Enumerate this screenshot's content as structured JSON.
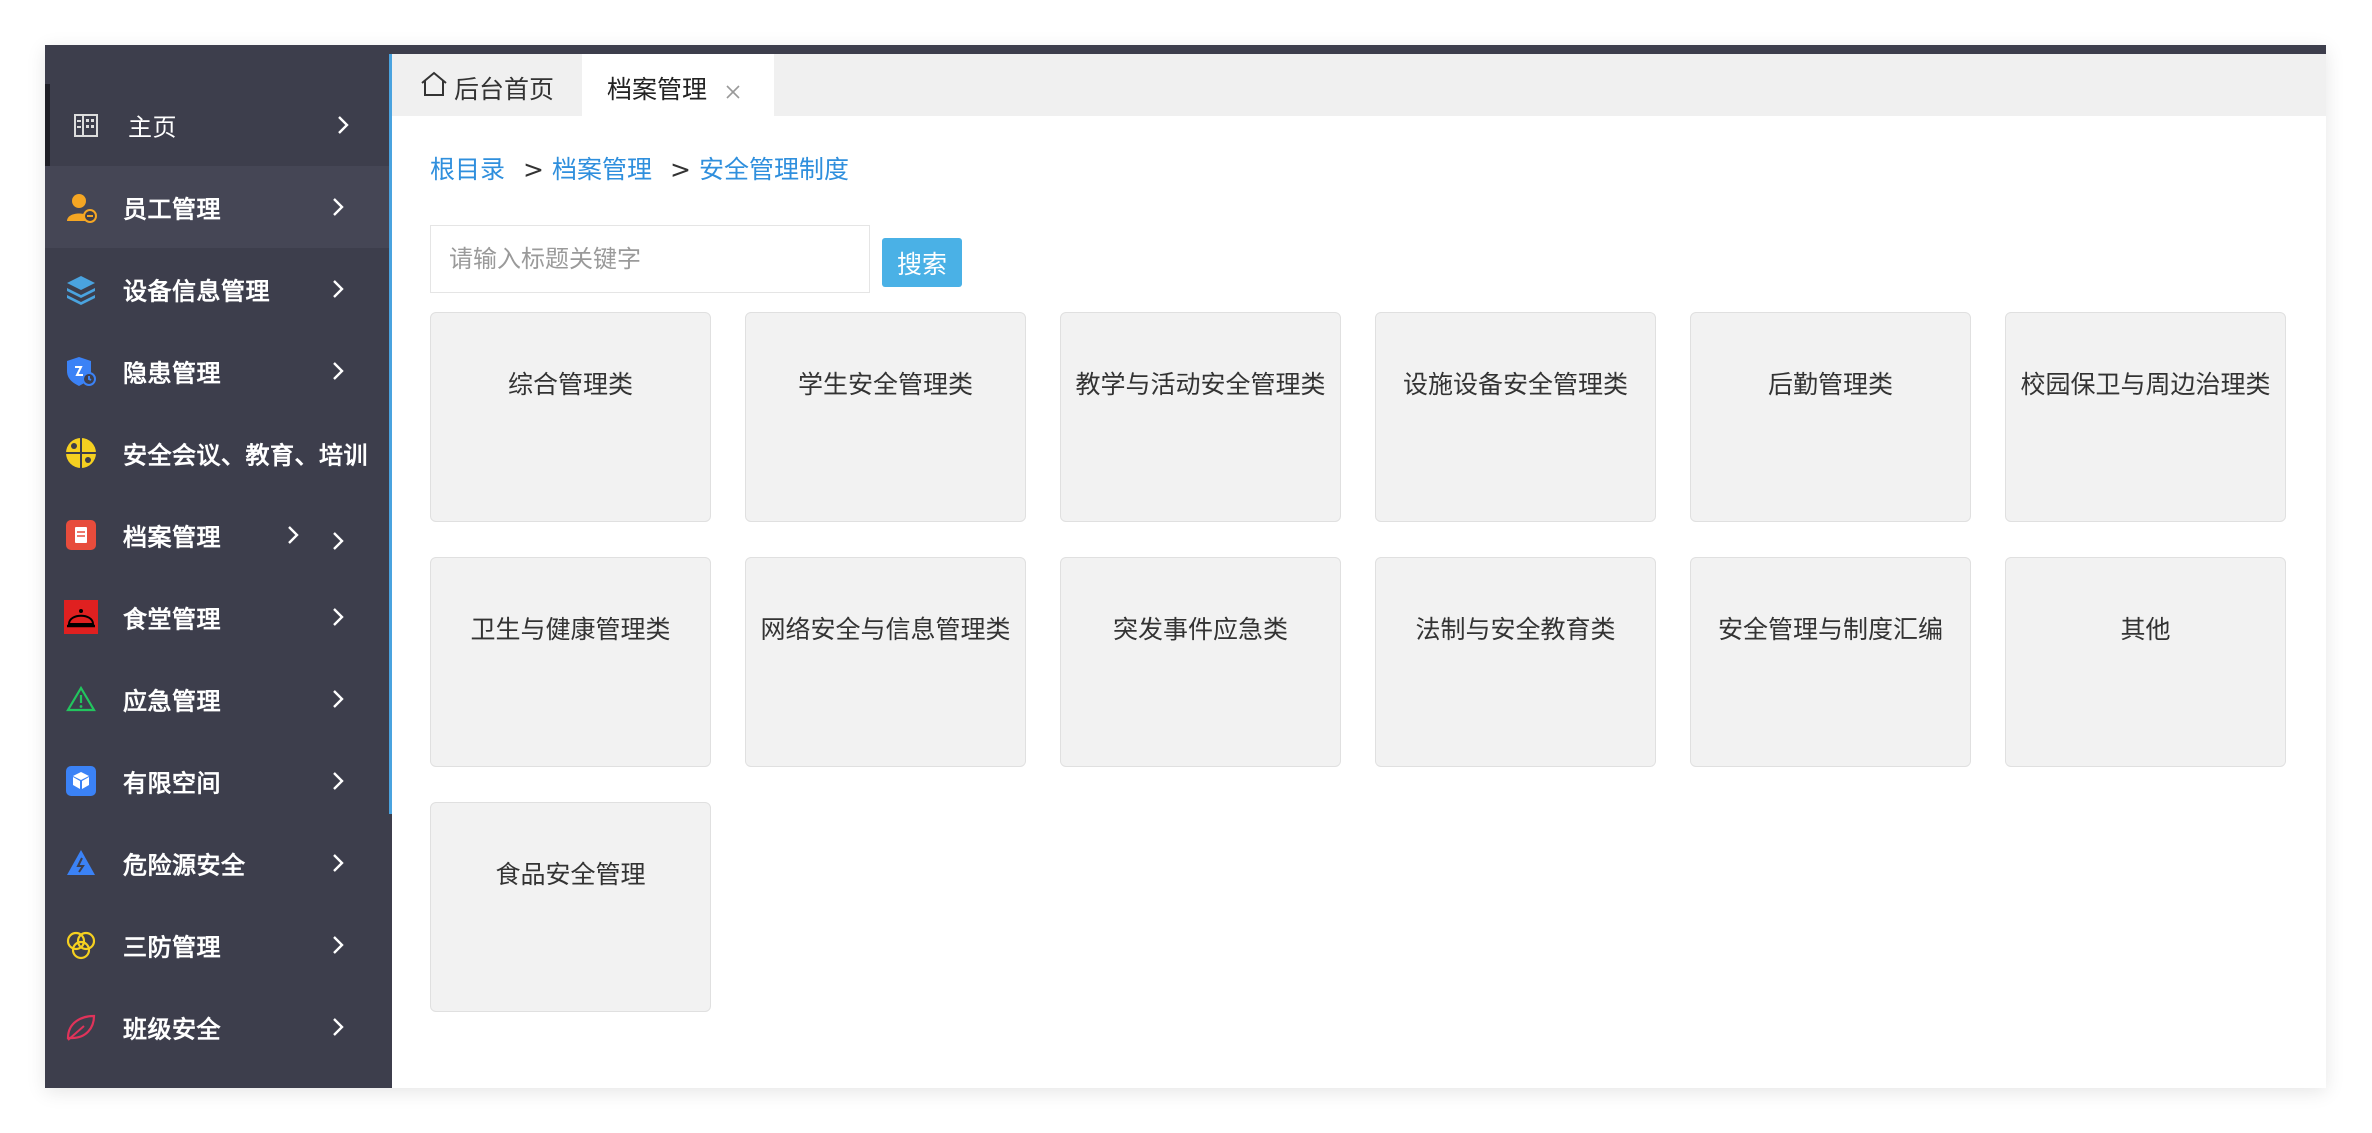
{
  "sidebar": {
    "items": [
      {
        "label": "主页",
        "icon": "building-icon",
        "icon_color": "#dddddd"
      },
      {
        "label": "员工管理",
        "icon": "user-icon",
        "icon_color": "#f5a623"
      },
      {
        "label": "设备信息管理",
        "icon": "layers-icon",
        "icon_color": "#4aa3df"
      },
      {
        "label": "隐患管理",
        "icon": "shield-icon",
        "icon_color": "#3b82f6"
      },
      {
        "label": "安全会议、教育、培训",
        "icon": "meeting-icon",
        "icon_color": "#f5d020"
      },
      {
        "label": "档案管理",
        "icon": "file-icon",
        "icon_color": "#e74c3c"
      },
      {
        "label": "食堂管理",
        "icon": "cloche-icon",
        "icon_color": "#e02020"
      },
      {
        "label": "应急管理",
        "icon": "warning-icon",
        "icon_color": "#22c55e"
      },
      {
        "label": "有限空间",
        "icon": "cube-icon",
        "icon_color": "#3b82f6"
      },
      {
        "label": "危险源安全",
        "icon": "hazard-icon",
        "icon_color": "#3b82f6"
      },
      {
        "label": "三防管理",
        "icon": "rings-icon",
        "icon_color": "#f5d020"
      },
      {
        "label": "班级安全",
        "icon": "leaf-icon",
        "icon_color": "#e0335a"
      }
    ]
  },
  "tabs": {
    "home": {
      "label": "后台首页",
      "icon": "home-icon"
    },
    "active": {
      "label": "档案管理",
      "icon": "close-icon"
    }
  },
  "breadcrumb": {
    "items": [
      "根目录",
      "档案管理",
      "安全管理制度"
    ],
    "separator": ">"
  },
  "search": {
    "placeholder": "请输入标题关键字",
    "value": "",
    "button_label": "搜索"
  },
  "categories": [
    "综合管理类",
    "学生安全管理类",
    "教学与活动安全管理类",
    "设施设备安全管理类",
    "后勤管理类",
    "校园保卫与周边治理类",
    "卫生与健康管理类",
    "网络安全与信息管理类",
    "突发事件应急类",
    "法制与安全教育类",
    "安全管理与制度汇编",
    "其他",
    "食品安全管理"
  ],
  "colors": {
    "sidebar_bg": "#3d3e4c",
    "accent_blue": "#4aa3df",
    "link_blue": "#2f8fdd",
    "button_blue": "#4ab1e6",
    "card_bg": "#f2f2f2"
  }
}
